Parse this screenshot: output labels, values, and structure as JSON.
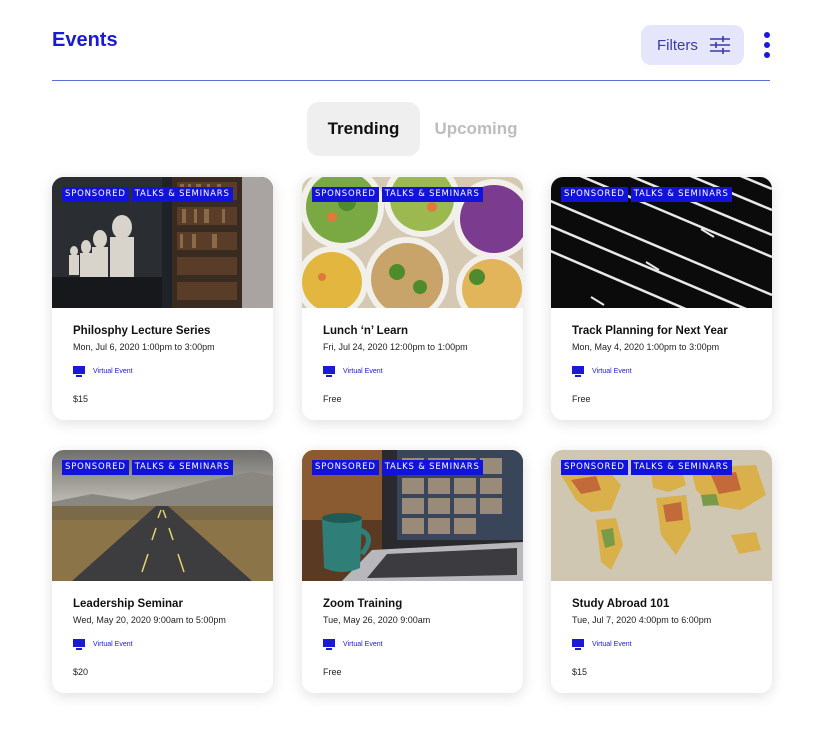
{
  "header": {
    "title": "Events",
    "filters_label": "Filters"
  },
  "tabs": [
    {
      "label": "Trending",
      "active": true
    },
    {
      "label": "Upcoming",
      "active": false
    }
  ],
  "colors": {
    "accent": "#1a1ad6",
    "tag_bg": "#1212dd",
    "filters_bg": "#e5e6fb",
    "active_tab_bg": "#efefef"
  },
  "cards": [
    {
      "tags": [
        "SPONSORED",
        "TALKS & SEMINARS"
      ],
      "title": "Philosphy Lecture Series",
      "date": "Mon, Jul 6, 2020 1:00pm to 3:00pm",
      "virtual_label": "Virtual Event",
      "price": "$15",
      "image": "library-busts"
    },
    {
      "tags": [
        "SPONSORED",
        "TALKS & SEMINARS"
      ],
      "title": "Lunch ‘n’ Learn",
      "date": "Fri, Jul 24, 2020 12:00pm to 1:00pm",
      "virtual_label": "Virtual Event",
      "price": "Free",
      "image": "salad-bowls"
    },
    {
      "tags": [
        "SPONSORED",
        "TALKS & SEMINARS"
      ],
      "title": "Track Planning for Next Year",
      "date": "Mon, May 4, 2020 1:00pm to 3:00pm",
      "virtual_label": "Virtual Event",
      "price": "Free",
      "image": "running-track"
    },
    {
      "tags": [
        "SPONSORED",
        "TALKS & SEMINARS"
      ],
      "title": "Leadership Seminar",
      "date": "Wed, May 20, 2020 9:00am to 5:00pm",
      "virtual_label": "Virtual Event",
      "price": "$20",
      "image": "road"
    },
    {
      "tags": [
        "SPONSORED",
        "TALKS & SEMINARS"
      ],
      "title": "Zoom Training",
      "date": "Tue, May 26, 2020 9:00am",
      "virtual_label": "Virtual Event",
      "price": "Free",
      "image": "laptop-video-call"
    },
    {
      "tags": [
        "SPONSORED",
        "TALKS & SEMINARS"
      ],
      "title": "Study Abroad 101",
      "date": "Tue, Jul 7, 2020 4:00pm to 6:00pm",
      "virtual_label": "Virtual Event",
      "price": "$15",
      "image": "world-map"
    }
  ]
}
